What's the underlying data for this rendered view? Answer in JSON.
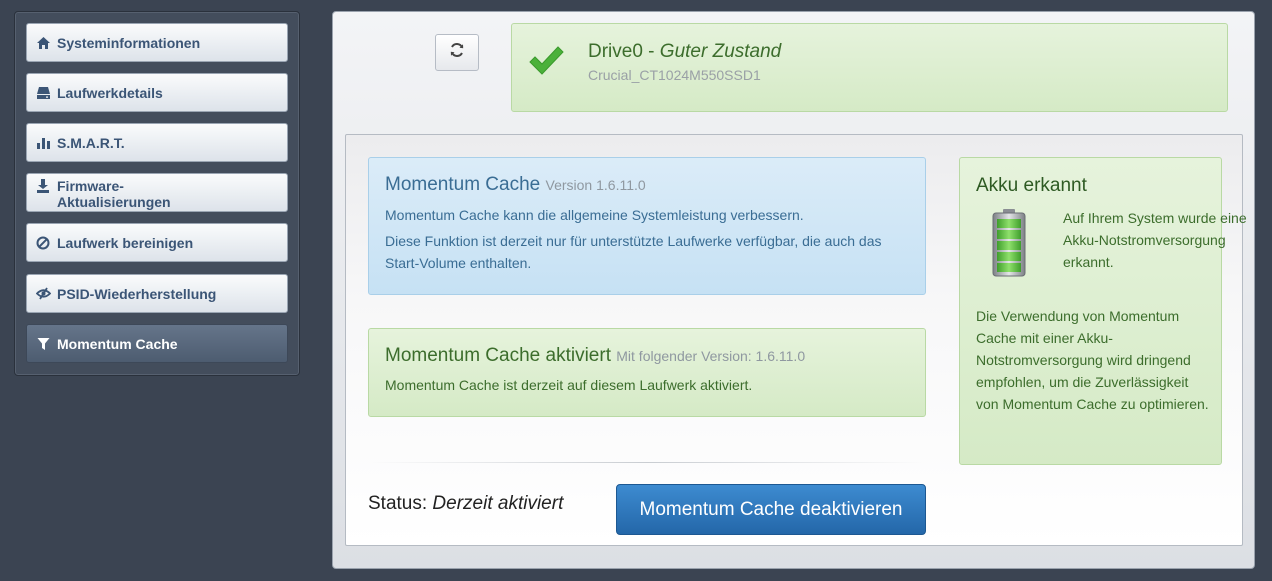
{
  "sidebar": {
    "items": [
      {
        "label": "Systeminformationen",
        "icon": "home-icon"
      },
      {
        "label": "Laufwerkdetails",
        "icon": "drive-icon"
      },
      {
        "label": "S.M.A.R.T.",
        "icon": "bar-chart-icon"
      },
      {
        "label": "Firmware-",
        "label2": "Aktualisierungen",
        "icon": "download-icon"
      },
      {
        "label": "Laufwerk bereinigen",
        "icon": "ban-icon"
      },
      {
        "label": "PSID-Wiederherstellung",
        "icon": "eye-slash-icon"
      },
      {
        "label": "Momentum Cache",
        "icon": "filter-icon",
        "active": true
      }
    ]
  },
  "drive": {
    "name": "Drive0 - ",
    "state": "Guter Zustand",
    "model": "Crucial_CT1024M550SSD1"
  },
  "momentum": {
    "title": "Momentum Cache",
    "version_text": "Version 1.6.11.0",
    "text1": "Momentum Cache kann die allgemeine Systemleistung verbessern.",
    "text2": "Diese Funktion ist derzeit nur für unterstützte Laufwerke verfügbar, die auch das Start-Volume enthalten."
  },
  "activated": {
    "title": "Momentum Cache aktiviert",
    "version_text": "Mit folgender Version: 1.6.11.0",
    "text": "Momentum Cache ist derzeit auf diesem Laufwerk aktiviert."
  },
  "status": {
    "label": "Status: ",
    "value": "Derzeit aktiviert"
  },
  "deactivate_button": "Momentum Cache deaktivieren",
  "akku": {
    "title": "Akku erkannt",
    "text1": "Auf Ihrem System wurde eine Akku-Notstromversorgung erkannt.",
    "text2": "Die Verwendung von Momentum Cache mit einer Akku-Notstromversorgung wird dringend empfohlen, um die Zuverlässigkeit von Momentum Cache zu optimieren."
  },
  "colors": {
    "background": "#3b4452",
    "nav_text": "#3b5576",
    "success_green": "#3c6d2c",
    "info_blue": "#3a6d94",
    "primary_button": "#2d78c0"
  }
}
